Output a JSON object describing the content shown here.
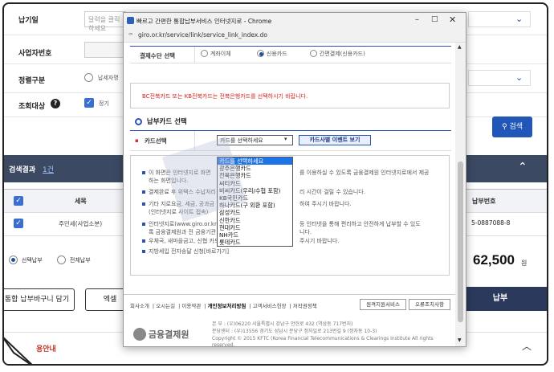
{
  "background": {
    "rows": [
      {
        "label": "납기일",
        "placeholder": "달력을 클릭하세요"
      },
      {
        "label": "사업자번호"
      },
      {
        "label": "정렬구분",
        "radio_label": "납세자명"
      },
      {
        "label": "조회대상",
        "check_label": "정기"
      }
    ],
    "search_button": "검색",
    "result_title": "검색결과",
    "result_count": "1건",
    "table": {
      "col_tax": "세목",
      "col_payno": "납부번호",
      "row_tax": "주민세(사업소분)",
      "row_payno": "5-0887088-8"
    },
    "select_option_1": "선택납부",
    "select_option_2": "전체납부",
    "total_amount": "62,500",
    "total_unit": "원",
    "cart_button": "통합 납부바구니 담기",
    "excel_button": "엑셀",
    "pay_button": "납부",
    "guide_title": "용안내",
    "guide_chevron": "︿"
  },
  "popup": {
    "window_title": "빠르고 간편한 통합납부서비스 인터넷지로 - Chrome",
    "url": "giro.or.kr/service/link/service_link_index.do",
    "payment_method_label": "결제수단 선택",
    "payment_methods": [
      "계좌이체",
      "신용카드",
      "간편결제(신용카드)"
    ],
    "notice": "BC전북카드 또는 KB전북카드는 전북은행카드를 선택하시기 바랍니다.",
    "section_title": "납부카드 선택",
    "card_select_label": "카드선택",
    "card_select_value": "카드를 선택하세요",
    "card_event_button": "카드사별 이벤트 보기",
    "card_options": [
      "카드를 선택하세요",
      "광주은행카드",
      "전북은행카드",
      "씨티카드",
      "비씨카드(우리/수협 포함)",
      "KB국민카드",
      "하나카드(구 외환 포함)",
      "삼성카드",
      "신한카드",
      "현대카드",
      "NH카드",
      "롯데카드"
    ],
    "info_lines": [
      "이 화면은 인터넷지로 화면",
      "를 이용하실 수 있도록 금융결제원 인터넷지로에서 제공",
      "하는 화면입니다.",
      "결제완료 후 위택스 수납처리",
      "리 시간이 걸릴 수 있습니다.",
      "기타 지로요금, 세금, 공과금",
      "하여 주시기 바랍니다.",
      "(인터넷지로 사이트 접속)",
      "인터넷지로(www.giro.or.kr)",
      "등 인터넷을 통해 편리하고 안전하게 납부할 수 있도",
      "록 금융결제원과 전 금융기관",
      "니다.",
      "우체국, 새마을금고, 신협 카드",
      "주시기 바랍니다.",
      "지방세입 전자송달 신청[바로가기]"
    ],
    "footer_links": [
      "회사소개",
      "오시는길",
      "이용약관",
      "개인정보처리방침",
      "고객서비스헌장",
      "저작권정책"
    ],
    "footer_btn_1": "원격지원서비스",
    "footer_btn_2": "오류조치사항",
    "brand_name": "금융결제원",
    "address_1": "본 부 : (우)06220 서울특별시 강남구 언헌로 432 (역삼동 717번지)",
    "address_2": "분당센터 : (우)13556 경기도 성남시 분당구 정자일로 213번길 9 (정자동 10-3)",
    "copyright": "Copyright © 2015 KFTC (Korea Financial Telecommunications & Clearings Institute All rights reserved."
  },
  "colors": {
    "accent": "#1f56b8",
    "dark_bar": "#3c4963",
    "notice_red": "#d9221c",
    "selection": "#1e73e8"
  }
}
